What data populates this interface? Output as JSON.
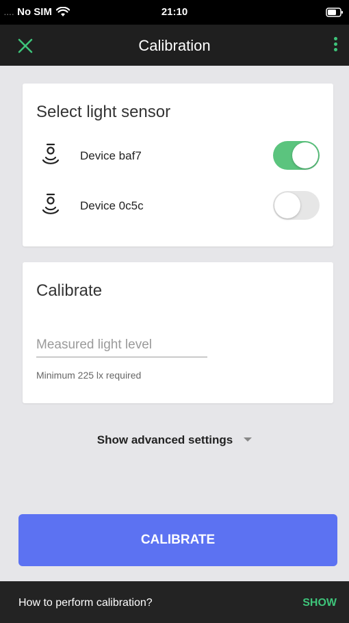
{
  "status_bar": {
    "signal_dots": "....",
    "carrier": "No SIM",
    "wifi_icon": "wifi-icon",
    "time": "21:10",
    "battery_icon": "battery-icon"
  },
  "toolbar": {
    "title": "Calibration",
    "close_icon": "close-icon",
    "more_icon": "more-vert-icon",
    "accent": "#3ec47a"
  },
  "sensors": {
    "title": "Select light sensor",
    "devices": [
      {
        "label": "Device baf7",
        "enabled": true,
        "icon": "light-sensor-icon"
      },
      {
        "label": "Device 0c5c",
        "enabled": false,
        "icon": "light-sensor-icon"
      }
    ],
    "toggle_on_color": "#5bc47e"
  },
  "calibrate": {
    "title": "Calibrate",
    "input_placeholder": "Measured light level",
    "input_value": "",
    "helper": "Minimum 225 lx required"
  },
  "advanced": {
    "label": "Show advanced settings",
    "icon": "caret-down-icon"
  },
  "calibrate_button": {
    "label": "CALIBRATE",
    "color": "#5c72f2"
  },
  "snackbar": {
    "text": "How to perform calibration?",
    "action": "SHOW"
  }
}
